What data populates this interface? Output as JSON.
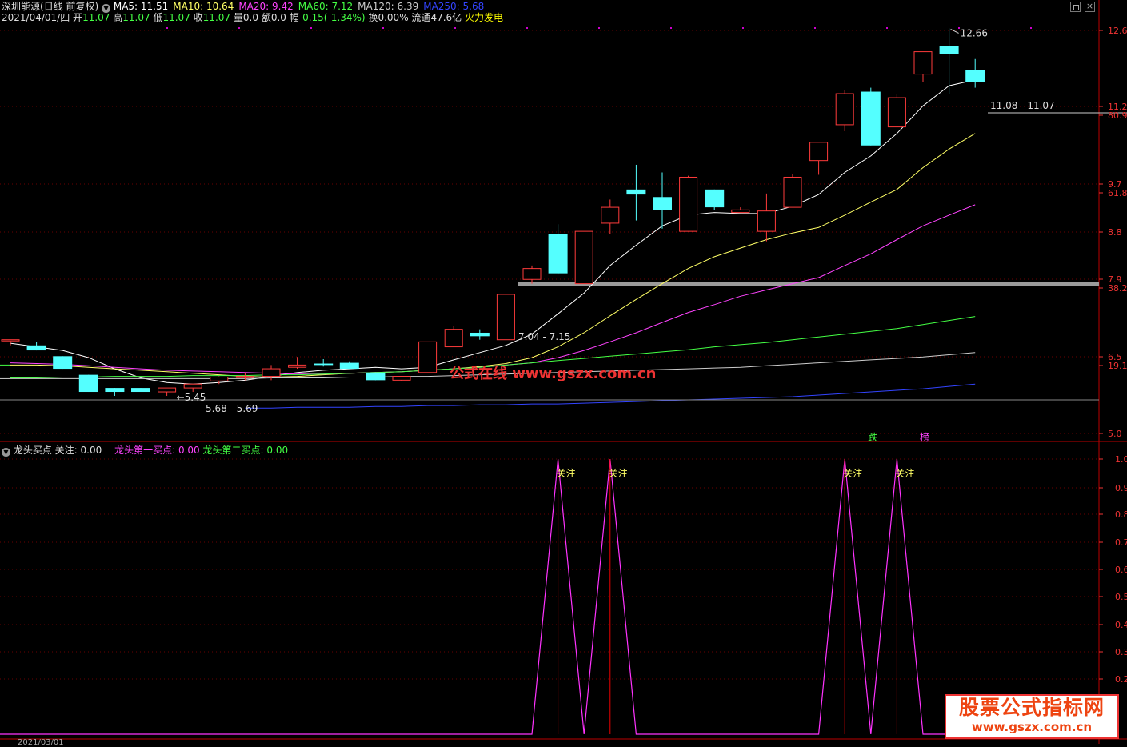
{
  "header": {
    "stock_name": "深圳能源",
    "mode": "(日线 前复权)",
    "ma": [
      {
        "label": "MA5:",
        "value": "11.51",
        "color": "#ffffff"
      },
      {
        "label": "MA10:",
        "value": "10.64",
        "color": "#ffff66"
      },
      {
        "label": "MA20:",
        "value": "9.42",
        "color": "#ff44ff"
      },
      {
        "label": "MA60:",
        "value": "7.12",
        "color": "#44ff44"
      },
      {
        "label": "MA120:",
        "value": "6.39",
        "color": "#cccccc"
      },
      {
        "label": "MA250:",
        "value": "5.68",
        "color": "#3344ff"
      }
    ],
    "info": {
      "date": "2021/04/01/四",
      "open_label": "开",
      "open": "11.07",
      "high_label": "高",
      "high": "11.07",
      "low_label": "低",
      "low": "11.07",
      "close_label": "收",
      "close": "11.07",
      "vol_label": "量",
      "vol": "0.0",
      "amt_label": "额",
      "amt": "0.0",
      "chg_label": "幅",
      "chg": "-0.15(-1.34%)",
      "turn_label": "换",
      "turn": "0.00%",
      "float_label": "流通",
      "float": "47.6亿",
      "concept": "火力发电"
    }
  },
  "axis_main": [
    "12.6",
    "11.2",
    "80.9",
    "9.7",
    "61.8",
    "8.8",
    "7.9",
    "38.2",
    "6.5",
    "19.1",
    "5.0"
  ],
  "axis_ind": [
    "1.0",
    "0.9",
    "0.8",
    "0.7",
    "0.6",
    "0.5",
    "0.4",
    "0.3",
    "0.2"
  ],
  "main_annotations": {
    "high": "12.66",
    "low": "5.45",
    "range1": "5.68 - 5.69",
    "range2": "7.04 - 7.15",
    "range3": "11.08 - 11.07"
  },
  "badges": {
    "die": "跌",
    "bang": "榜"
  },
  "watermark": "公式在线  www.gszx.com.cn",
  "indicator": {
    "name": "龙头买点",
    "guanzhu_label": "关注:",
    "guanzhu_value": "0.00",
    "first_label": "龙头第一买点:",
    "first_value": "0.00",
    "second_label": "龙头第二买点:",
    "second_value": "0.00",
    "signal_label": "关注"
  },
  "bottom_date": "2021/03/01",
  "logo": {
    "line1": "股票公式指标网",
    "line2": "www.gszx.com.cn"
  },
  "chart_data": {
    "type": "candlestick",
    "price_axis_range": [
      5.0,
      12.6
    ],
    "candles": [
      {
        "o": 6.2,
        "h": 6.2,
        "l": 6.12,
        "c": 6.2
      },
      {
        "o": 6.12,
        "h": 6.17,
        "l": 6.05,
        "c": 6.05
      },
      {
        "o": 5.97,
        "h": 5.97,
        "l": 5.8,
        "c": 5.8
      },
      {
        "o": 5.72,
        "h": 5.72,
        "l": 5.5,
        "c": 5.5
      },
      {
        "o": 5.55,
        "h": 5.55,
        "l": 5.45,
        "c": 5.5
      },
      {
        "o": 5.55,
        "h": 5.55,
        "l": 5.5,
        "c": 5.5
      },
      {
        "o": 5.5,
        "h": 5.55,
        "l": 5.45,
        "c": 5.55
      },
      {
        "o": 5.55,
        "h": 5.6,
        "l": 5.5,
        "c": 5.6
      },
      {
        "o": 5.64,
        "h": 5.7,
        "l": 5.6,
        "c": 5.69
      },
      {
        "o": 5.69,
        "h": 5.75,
        "l": 5.65,
        "c": 5.7
      },
      {
        "o": 5.7,
        "h": 5.85,
        "l": 5.65,
        "c": 5.8
      },
      {
        "o": 5.82,
        "h": 5.96,
        "l": 5.8,
        "c": 5.85
      },
      {
        "o": 5.87,
        "h": 5.93,
        "l": 5.83,
        "c": 5.85
      },
      {
        "o": 5.88,
        "h": 5.9,
        "l": 5.8,
        "c": 5.8
      },
      {
        "o": 5.75,
        "h": 5.75,
        "l": 5.65,
        "c": 5.65
      },
      {
        "o": 5.65,
        "h": 5.7,
        "l": 5.64,
        "c": 5.7
      },
      {
        "o": 5.75,
        "h": 6.17,
        "l": 5.75,
        "c": 6.17
      },
      {
        "o": 6.1,
        "h": 6.4,
        "l": 6.1,
        "c": 6.35
      },
      {
        "o": 6.3,
        "h": 6.35,
        "l": 6.2,
        "c": 6.25
      },
      {
        "o": 6.2,
        "h": 6.88,
        "l": 6.2,
        "c": 6.88
      },
      {
        "o": 7.12,
        "h": 7.35,
        "l": 7.05,
        "c": 7.3
      },
      {
        "o": 7.9,
        "h": 8.08,
        "l": 7.2,
        "c": 7.22
      },
      {
        "o": 7.05,
        "h": 7.95,
        "l": 7.05,
        "c": 7.95
      },
      {
        "o": 8.1,
        "h": 8.55,
        "l": 7.9,
        "c": 8.4
      },
      {
        "o": 8.75,
        "h": 9.26,
        "l": 8.15,
        "c": 8.65
      },
      {
        "o": 8.6,
        "h": 9.1,
        "l": 8.0,
        "c": 8.35
      },
      {
        "o": 7.95,
        "h": 9.03,
        "l": 7.95,
        "c": 9.0
      },
      {
        "o": 8.75,
        "h": 8.75,
        "l": 8.35,
        "c": 8.4
      },
      {
        "o": 8.3,
        "h": 8.4,
        "l": 8.3,
        "c": 8.35
      },
      {
        "o": 7.95,
        "h": 8.67,
        "l": 7.77,
        "c": 8.33
      },
      {
        "o": 8.4,
        "h": 9.07,
        "l": 8.4,
        "c": 9.0
      },
      {
        "o": 9.35,
        "h": 9.72,
        "l": 9.05,
        "c": 9.75
      },
      {
        "o": 10.15,
        "h": 11.0,
        "l": 10.0,
        "c": 10.9
      },
      {
        "o": 10.95,
        "h": 11.05,
        "l": 9.68,
        "c": 9.68
      },
      {
        "o": 10.1,
        "h": 10.9,
        "l": 10.1,
        "c": 10.8
      },
      {
        "o": 11.4,
        "h": 12.0,
        "l": 11.2,
        "c": 12.0
      },
      {
        "o": 12.15,
        "h": 12.66,
        "l": 10.9,
        "c": 11.93
      },
      {
        "o": 11.5,
        "h": 11.8,
        "l": 11.05,
        "c": 11.2
      }
    ],
    "ma_lines": {
      "MA5": [
        6.15,
        6.1,
        6.05,
        5.95,
        5.8,
        5.68,
        5.62,
        5.6,
        5.62,
        5.65,
        5.7,
        5.75,
        5.78,
        5.8,
        5.82,
        5.8,
        5.82,
        5.92,
        6.02,
        6.12,
        6.28,
        6.58,
        6.9,
        7.35,
        7.7,
        8.05,
        8.25,
        8.3,
        8.28,
        8.28,
        8.42,
        8.65,
        9.1,
        9.45,
        9.95,
        10.6,
        11.1,
        11.25
      ],
      "MA10": [
        5.85,
        5.85,
        5.84,
        5.82,
        5.8,
        5.78,
        5.76,
        5.74,
        5.72,
        5.7,
        5.69,
        5.7,
        5.72,
        5.74,
        5.75,
        5.76,
        5.78,
        5.8,
        5.83,
        5.87,
        5.95,
        6.1,
        6.3,
        6.55,
        6.8,
        7.05,
        7.3,
        7.5,
        7.65,
        7.8,
        7.92,
        8.02,
        8.25,
        8.5,
        8.75,
        9.2,
        9.6,
        9.95
      ],
      "MA20": [
        5.88,
        5.87,
        5.86,
        5.84,
        5.82,
        5.8,
        5.78,
        5.77,
        5.76,
        5.75,
        5.74,
        5.73,
        5.73,
        5.74,
        5.75,
        5.76,
        5.78,
        5.8,
        5.82,
        5.85,
        5.88,
        5.95,
        6.05,
        6.17,
        6.3,
        6.45,
        6.6,
        6.72,
        6.85,
        6.95,
        7.05,
        7.15,
        7.35,
        7.55,
        7.8,
        8.05,
        8.25,
        8.45
      ],
      "MA60": [
        5.68,
        5.68,
        5.69,
        5.69,
        5.7,
        5.7,
        5.7,
        5.71,
        5.71,
        5.71,
        5.72,
        5.72,
        5.73,
        5.74,
        5.75,
        5.76,
        5.78,
        5.8,
        5.82,
        5.85,
        5.88,
        5.91,
        5.94,
        5.97,
        6.0,
        6.03,
        6.06,
        6.1,
        6.13,
        6.16,
        6.2,
        6.24,
        6.28,
        6.32,
        6.36,
        6.42,
        6.48,
        6.54
      ],
      "MA120": [
        5.67,
        5.67,
        5.67,
        5.67,
        5.67,
        5.67,
        5.67,
        5.67,
        5.67,
        5.67,
        5.68,
        5.68,
        5.68,
        5.69,
        5.69,
        5.7,
        5.7,
        5.71,
        5.72,
        5.73,
        5.74,
        5.75,
        5.76,
        5.77,
        5.78,
        5.79,
        5.8,
        5.81,
        5.82,
        5.84,
        5.86,
        5.88,
        5.9,
        5.92,
        5.94,
        5.96,
        5.99,
        6.02
      ],
      "MA250": [
        null,
        null,
        null,
        null,
        null,
        null,
        null,
        null,
        null,
        5.3,
        5.3,
        5.31,
        5.31,
        5.31,
        5.32,
        5.32,
        5.33,
        5.33,
        5.34,
        5.34,
        5.35,
        5.35,
        5.36,
        5.37,
        5.38,
        5.39,
        5.4,
        5.41,
        5.42,
        5.43,
        5.44,
        5.46,
        5.48,
        5.5,
        5.52,
        5.54,
        5.57,
        5.6
      ]
    },
    "level_band": 7.04,
    "indicator_values": [
      0,
      0,
      0,
      0,
      0,
      0,
      0,
      0,
      0,
      0,
      0,
      0,
      0,
      0,
      0,
      0,
      0,
      0,
      0,
      0,
      0,
      1,
      0,
      1,
      0,
      0,
      0,
      0,
      0,
      0,
      0,
      0,
      1,
      0,
      1,
      0,
      0,
      0
    ],
    "indicator_range": [
      0,
      1.0
    ]
  }
}
